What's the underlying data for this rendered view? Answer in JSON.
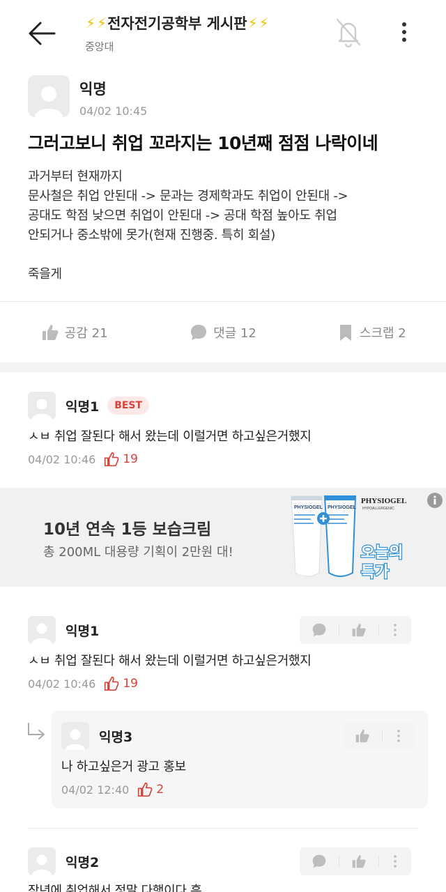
{
  "header": {
    "bolt": "⚡",
    "board_title": "전자전기공학부 게시판",
    "school": "중앙대"
  },
  "post": {
    "author": "익명",
    "date": "04/02 10:45",
    "title": "그러고보니 취업 꼬라지는 10년째 점점 나락이네",
    "body_lines": [
      "과거부터 현재까지",
      "문사철은 취업 안된대 -> 문과는 경제학과도 취업이 안된대 ->",
      "공대도 학점 낮으면 취업이 안된대 -> 공대 학점 높아도 취업",
      "안되거나 중소밖에 못가(현재 진행중. 특히 회설)",
      "죽을게"
    ],
    "likes_label": "공감 21",
    "comments_label": "댓글 12",
    "scrap_label": "스크랩 2"
  },
  "best_comment": {
    "author": "익명1",
    "badge": "BEST",
    "text": "ㅅㅂ 취업 잘된다 해서 왔는데 이럴거면 하고싶은거했지",
    "date": "04/02 10:46",
    "likes": "19"
  },
  "ad": {
    "title": "10년 연속 1등 보습크림",
    "subtitle": "총 200ML 대용량 기획이 2만원 대!",
    "brand": "PHYSIOGEL",
    "brand_sub": "HYPOALLERGENIC",
    "badge_line1": "오늘의",
    "badge_line2": "특가"
  },
  "comments": [
    {
      "author": "익명1",
      "text": "ㅅㅂ 취업 잘된다 해서 왔는데 이럴거면 하고싶은거했지",
      "date": "04/02 10:46",
      "likes": "19"
    },
    {
      "author": "익명2",
      "text": "작년에 취업해서 정말 다행이다 흑"
    }
  ],
  "reply": {
    "author": "익명3",
    "text": "나 하고싶은거 광고 홍보",
    "date": "04/02 12:40",
    "likes": "2"
  },
  "colors": {
    "accent_red": "#d9423a",
    "bolt_yellow": "#f2c200",
    "muted": "#999999"
  }
}
